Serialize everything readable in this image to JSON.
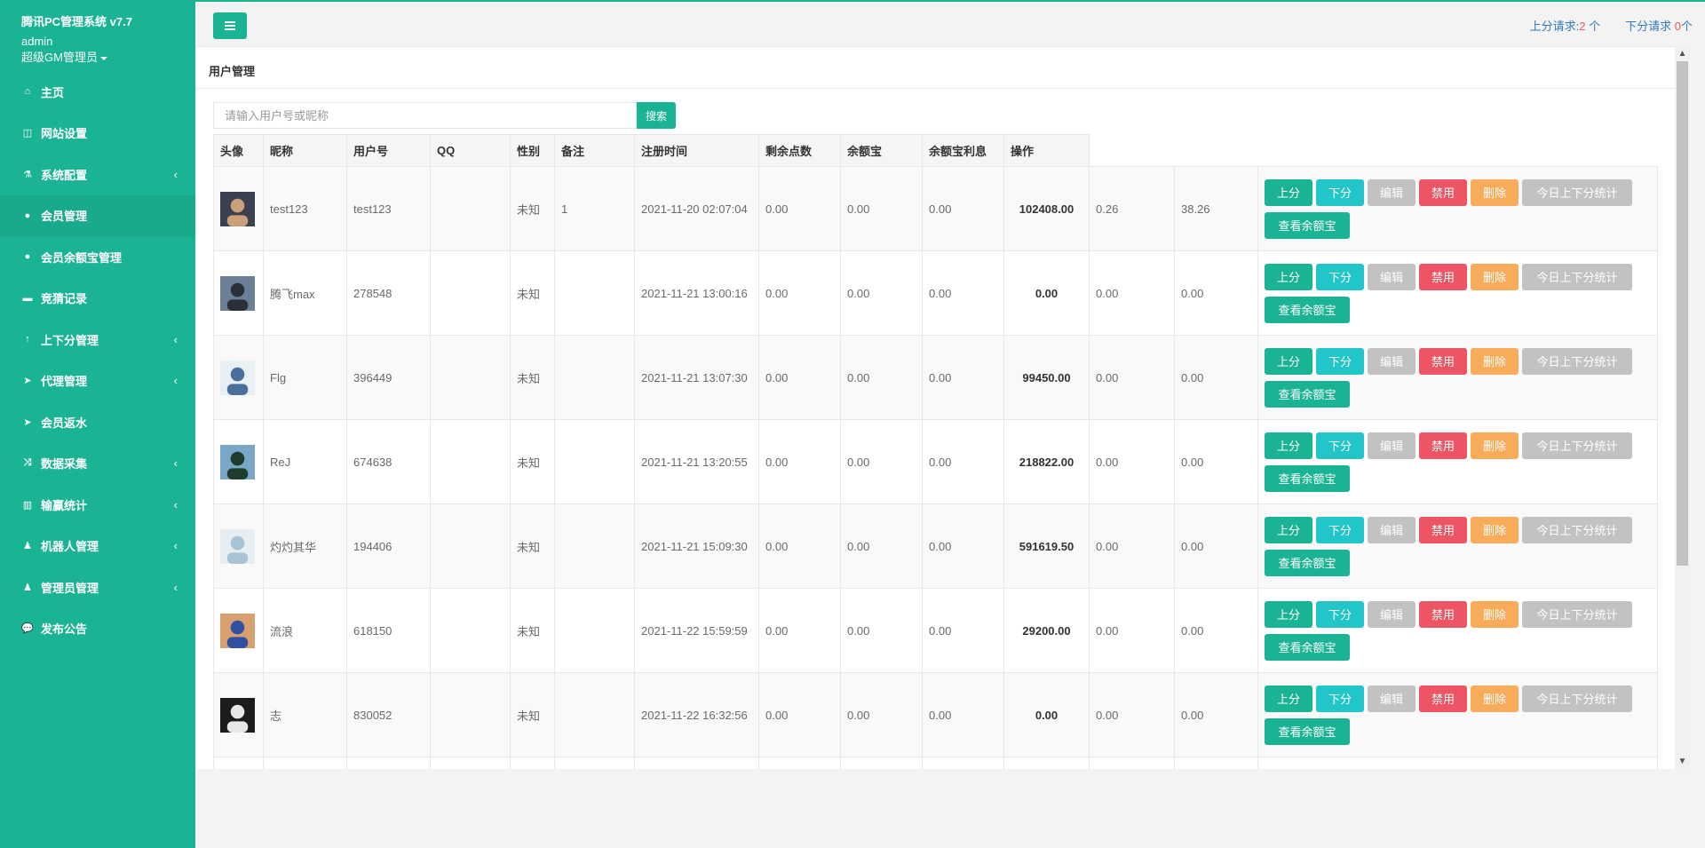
{
  "brand": {
    "title": "腾讯PC管理系统 v7.7",
    "username": "admin",
    "role": "超级GM管理员"
  },
  "nav": [
    {
      "label": "主页",
      "icon": "home-icon",
      "glyph": "⌂",
      "has_arrow": false,
      "active": false
    },
    {
      "label": "网站设置",
      "icon": "columns-icon",
      "glyph": "◫",
      "has_arrow": false,
      "active": false
    },
    {
      "label": "系统配置",
      "icon": "flask-icon",
      "glyph": "⚗",
      "has_arrow": true,
      "active": false
    },
    {
      "label": "会员管理",
      "icon": "user-icon",
      "glyph": "●",
      "has_arrow": false,
      "active": true
    },
    {
      "label": "会员余额宝管理",
      "icon": "user-icon",
      "glyph": "●",
      "has_arrow": false,
      "active": false
    },
    {
      "label": "竞猜记录",
      "icon": "car-icon",
      "glyph": "▬",
      "has_arrow": false,
      "active": false
    },
    {
      "label": "上下分管理",
      "icon": "level-up-icon",
      "glyph": "↑",
      "has_arrow": true,
      "active": false
    },
    {
      "label": "代理管理",
      "icon": "paper-plane-icon",
      "glyph": "➤",
      "has_arrow": true,
      "active": false
    },
    {
      "label": "会员返水",
      "icon": "paper-plane-icon",
      "glyph": "➤",
      "has_arrow": false,
      "active": false
    },
    {
      "label": "数据采集",
      "icon": "random-icon",
      "glyph": "⤨",
      "has_arrow": true,
      "active": false
    },
    {
      "label": "输赢统计",
      "icon": "bar-chart-icon",
      "glyph": "▥",
      "has_arrow": true,
      "active": false
    },
    {
      "label": "机器人管理",
      "icon": "male-icon",
      "glyph": "♟",
      "has_arrow": true,
      "active": false
    },
    {
      "label": "管理员管理",
      "icon": "male-icon",
      "glyph": "♟",
      "has_arrow": true,
      "active": false
    },
    {
      "label": "发布公告",
      "icon": "comment-icon",
      "glyph": "💬",
      "has_arrow": false,
      "active": false
    }
  ],
  "topbar": {
    "up_label": "上分请求:",
    "up_count": "2",
    "up_unit": " 个",
    "down_label": "下分请求 ",
    "down_count": "0",
    "down_unit": "个"
  },
  "panel": {
    "title": "用户管理",
    "search_placeholder": "请输入用户号或昵称",
    "search_button": "搜索"
  },
  "table": {
    "headers": [
      "头像",
      "昵称",
      "用户号",
      "QQ",
      "性别",
      "备注",
      "注册时间",
      "剩余点数",
      "余额宝",
      "余额宝利息",
      "操作"
    ],
    "buttons": {
      "up": "上分",
      "down": "下分",
      "edit": "编辑",
      "ban": "禁用",
      "del": "删除",
      "stat": "今日上下分统计",
      "view": "查看余额宝"
    },
    "rows": [
      {
        "nick": "test123",
        "uid": "test123",
        "qq": "",
        "gender": "未知",
        "note": "1",
        "reg": "2021-11-20 02:07:04",
        "points": "0.00",
        "yeb": "0.00",
        "interest": "0.00",
        "c1": "102408.00",
        "c2": "0.26",
        "c3": "38.26",
        "avatar_color": "#3a4050",
        "avatar_accent": "#c9a07a"
      },
      {
        "nick": "腾飞max",
        "uid": "278548",
        "qq": "",
        "gender": "未知",
        "note": "",
        "reg": "2021-11-21 13:00:16",
        "points": "0.00",
        "yeb": "0.00",
        "interest": "0.00",
        "c1": "0.00",
        "c2": "0.00",
        "c3": "0.00",
        "avatar_color": "#6b7f99",
        "avatar_accent": "#2b2f38"
      },
      {
        "nick": "Flg",
        "uid": "396449",
        "qq": "",
        "gender": "未知",
        "note": "",
        "reg": "2021-11-21 13:07:30",
        "points": "0.00",
        "yeb": "0.00",
        "interest": "0.00",
        "c1": "99450.00",
        "c2": "0.00",
        "c3": "0.00",
        "avatar_color": "#e8f0f4",
        "avatar_accent": "#4a6f9a"
      },
      {
        "nick": "ReJ",
        "uid": "674638",
        "qq": "",
        "gender": "未知",
        "note": "",
        "reg": "2021-11-21 13:20:55",
        "points": "0.00",
        "yeb": "0.00",
        "interest": "0.00",
        "c1": "218822.00",
        "c2": "0.00",
        "c3": "0.00",
        "avatar_color": "#7aa6c8",
        "avatar_accent": "#1f3d2a"
      },
      {
        "nick": "灼灼其华",
        "uid": "194406",
        "qq": "",
        "gender": "未知",
        "note": "",
        "reg": "2021-11-21 15:09:30",
        "points": "0.00",
        "yeb": "0.00",
        "interest": "0.00",
        "c1": "591619.50",
        "c2": "0.00",
        "c3": "0.00",
        "avatar_color": "#e6eef2",
        "avatar_accent": "#a8c4d4"
      },
      {
        "nick": "流浪",
        "uid": "618150",
        "qq": "",
        "gender": "未知",
        "note": "",
        "reg": "2021-11-22 15:59:59",
        "points": "0.00",
        "yeb": "0.00",
        "interest": "0.00",
        "c1": "29200.00",
        "c2": "0.00",
        "c3": "0.00",
        "avatar_color": "#d8a070",
        "avatar_accent": "#3050a0"
      },
      {
        "nick": "志",
        "uid": "830052",
        "qq": "",
        "gender": "未知",
        "note": "",
        "reg": "2021-11-22 16:32:56",
        "points": "0.00",
        "yeb": "0.00",
        "interest": "0.00",
        "c1": "0.00",
        "c2": "0.00",
        "c3": "0.00",
        "avatar_color": "#1c1c1c",
        "avatar_accent": "#e8e8e8"
      },
      {
        "nick": "",
        "uid": "",
        "qq": "",
        "gender": "",
        "note": "",
        "reg": "",
        "points": "",
        "yeb": "",
        "interest": "",
        "c1": "",
        "c2": "",
        "c3": "",
        "avatar_color": "#cccccc",
        "avatar_accent": "#999999"
      }
    ]
  },
  "colors": {
    "primary": "#1ab394",
    "info": "#23c6c8",
    "danger": "#ed5565",
    "warning": "#f8ac59",
    "muted": "#c2c2c2"
  }
}
